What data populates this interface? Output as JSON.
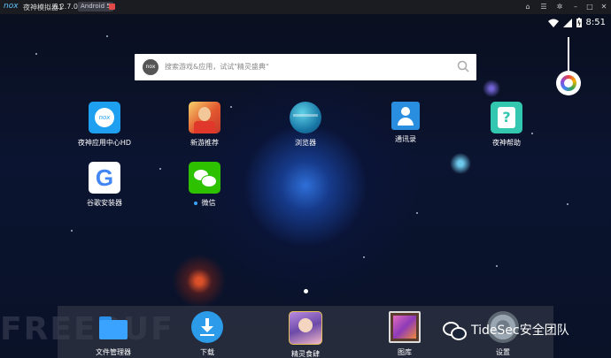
{
  "window": {
    "logo": "nox",
    "title": "夜神模拟器1",
    "version": "6.2.7.0",
    "android": "Android 5"
  },
  "status": {
    "time": "8:51"
  },
  "search": {
    "placeholder": "搜索游戏&应用，试试\"精灵盛典\"",
    "logo_text": "nox"
  },
  "apps": [
    {
      "label": "夜神应用中心HD",
      "icon": "nox-appcenter-icon"
    },
    {
      "label": "新游推荐",
      "icon": "new-games-icon"
    },
    {
      "label": "浏览器",
      "icon": "browser-icon"
    },
    {
      "label": "通讯录",
      "icon": "contacts-icon"
    },
    {
      "label": "夜神帮助",
      "icon": "help-icon"
    },
    {
      "label": "谷歌安装器",
      "icon": "google-installer-icon"
    },
    {
      "label": "微信",
      "icon": "wechat-icon"
    }
  ],
  "dock": [
    {
      "label": "文件管理器",
      "icon": "folder-icon"
    },
    {
      "label": "下载",
      "icon": "download-icon"
    },
    {
      "label": "精灵食肆",
      "icon": "game-icon"
    },
    {
      "label": "图库",
      "icon": "gallery-icon"
    },
    {
      "label": "设置",
      "icon": "settings-icon"
    }
  ],
  "watermark": {
    "freebuf": "FREEBUF",
    "brand": "TideSec安全团队"
  },
  "colors": {
    "accent": "#3aa3ff",
    "titlebar": "#1b1c22",
    "wechat": "#2dc100"
  }
}
